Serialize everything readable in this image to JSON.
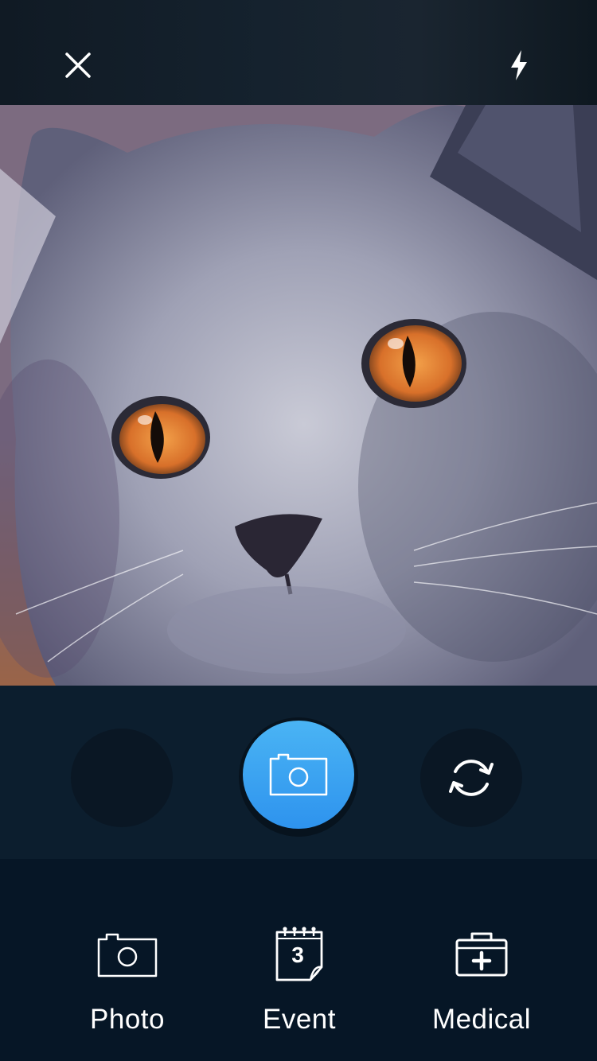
{
  "top_bar": {
    "close_icon": "close-icon",
    "flash_icon": "flash-icon"
  },
  "viewfinder": {
    "subject": "cat-photo"
  },
  "controls": {
    "shutter_icon": "camera-icon",
    "switch_icon": "refresh-icon",
    "accent": "#3aa3f2"
  },
  "tabs": [
    {
      "label": "Photo",
      "icon": "camera-icon"
    },
    {
      "label": "Event",
      "icon": "calendar-icon",
      "icon_text": "3"
    },
    {
      "label": "Medical",
      "icon": "medical-kit-icon"
    }
  ]
}
